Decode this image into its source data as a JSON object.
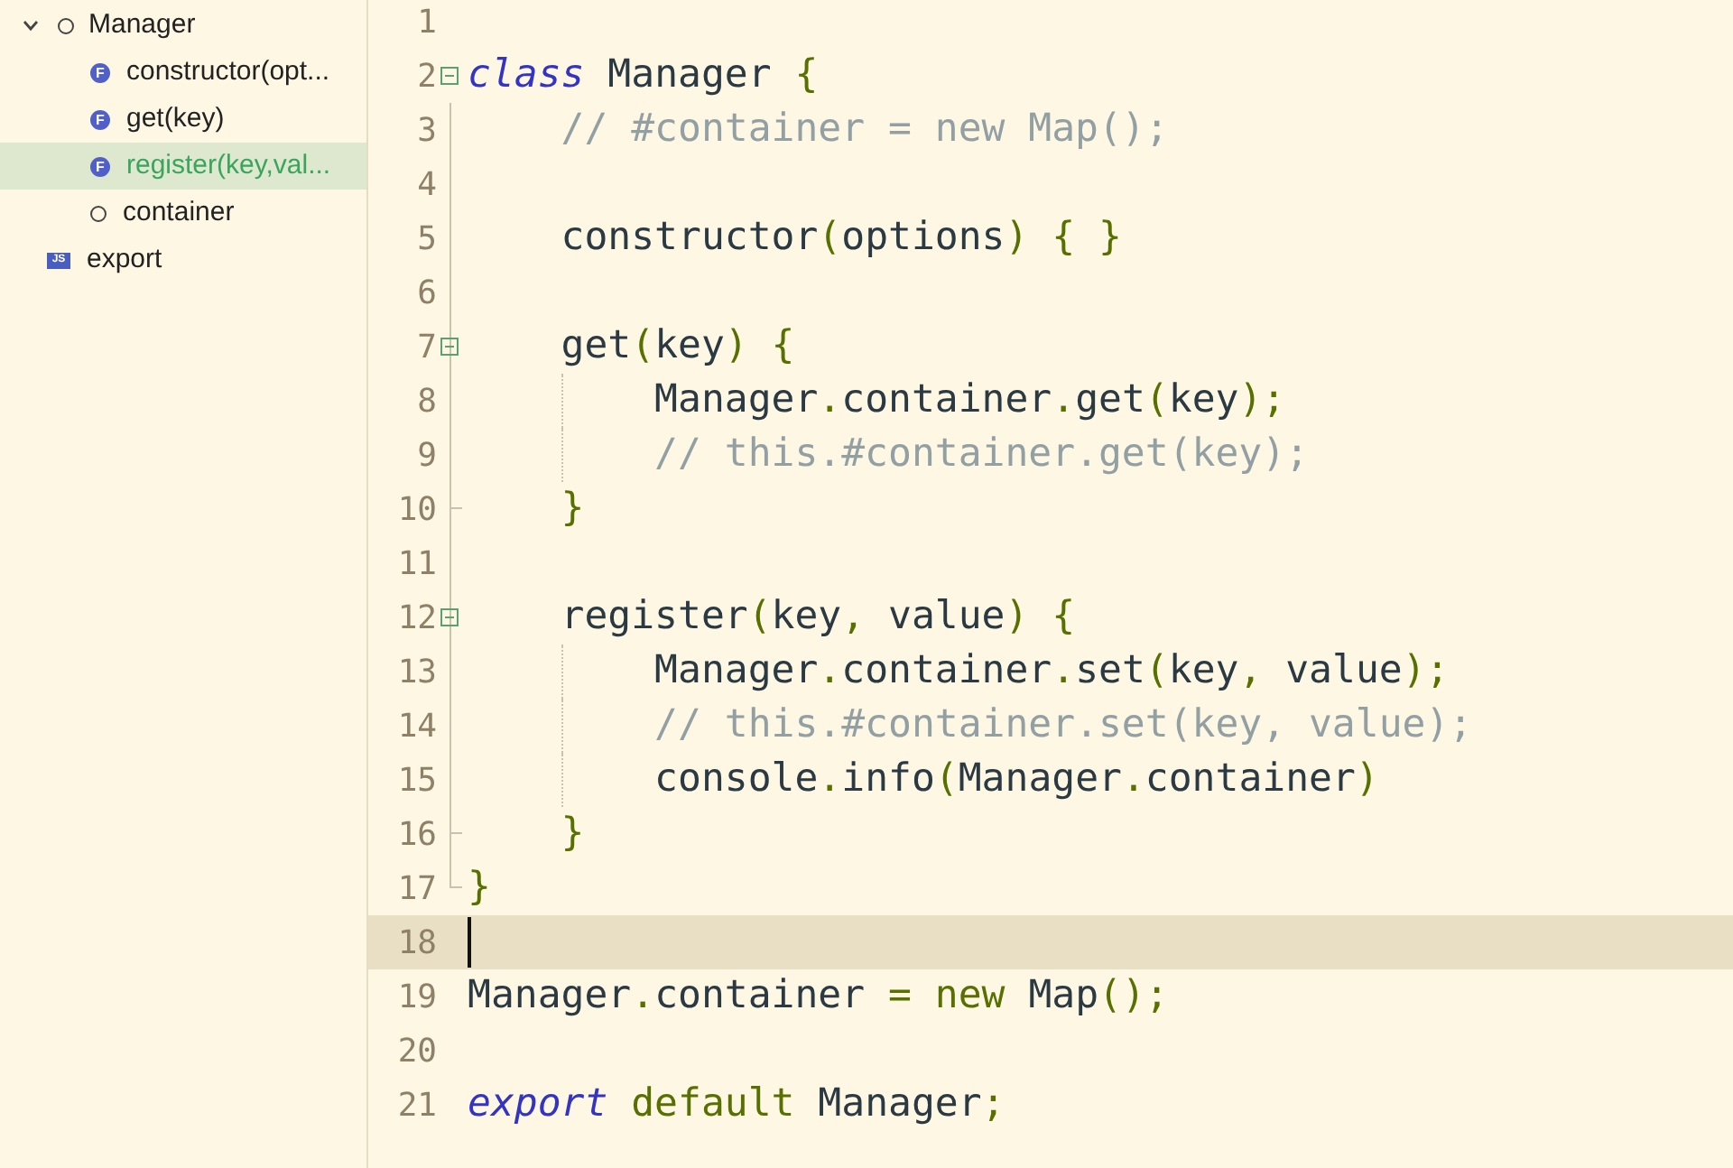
{
  "outline": {
    "items": [
      {
        "label": "Manager",
        "kind": "class",
        "expanded": true,
        "selected": false,
        "children": [
          {
            "label": "constructor(opt...",
            "kind": "method",
            "badge": "F",
            "selected": false
          },
          {
            "label": "get(key)",
            "kind": "method",
            "badge": "F",
            "selected": false
          },
          {
            "label": "register(key,val...",
            "kind": "method",
            "badge": "F",
            "selected": true
          },
          {
            "label": "container",
            "kind": "field",
            "selected": false
          }
        ]
      },
      {
        "label": "export",
        "kind": "module",
        "badge": "JS",
        "expanded": false,
        "selected": false
      }
    ]
  },
  "editor": {
    "lines": [
      {
        "number": "1"
      },
      {
        "number": "2",
        "fold_start": true,
        "tokens": [
          {
            "text": "class",
            "kind": "keyword"
          },
          {
            "text": " Manager ",
            "kind": "plain"
          },
          {
            "text": "{",
            "kind": "punct"
          }
        ]
      },
      {
        "number": "3",
        "tokens": [
          {
            "text": "    // #container = new Map();",
            "kind": "comment"
          }
        ]
      },
      {
        "number": "4"
      },
      {
        "number": "5",
        "tokens": [
          {
            "text": "    constructor",
            "kind": "plain"
          },
          {
            "text": "(",
            "kind": "punct"
          },
          {
            "text": "options",
            "kind": "plain"
          },
          {
            "text": ") { }",
            "kind": "punct"
          }
        ]
      },
      {
        "number": "6"
      },
      {
        "number": "7",
        "fold_start": true,
        "tokens": [
          {
            "text": "    get",
            "kind": "plain"
          },
          {
            "text": "(",
            "kind": "punct"
          },
          {
            "text": "key",
            "kind": "plain"
          },
          {
            "text": ") {",
            "kind": "punct"
          }
        ]
      },
      {
        "number": "8",
        "guide": true,
        "tokens": [
          {
            "text": "        Manager",
            "kind": "plain"
          },
          {
            "text": ".",
            "kind": "punct"
          },
          {
            "text": "container",
            "kind": "plain"
          },
          {
            "text": ".",
            "kind": "punct"
          },
          {
            "text": "get",
            "kind": "plain"
          },
          {
            "text": "(",
            "kind": "punct"
          },
          {
            "text": "key",
            "kind": "plain"
          },
          {
            "text": ");",
            "kind": "punct"
          }
        ]
      },
      {
        "number": "9",
        "guide": true,
        "tokens": [
          {
            "text": "        // this.#container.get(key);",
            "kind": "comment"
          }
        ]
      },
      {
        "number": "10",
        "fold_end": true,
        "tokens": [
          {
            "text": "    }",
            "kind": "punct"
          }
        ]
      },
      {
        "number": "11"
      },
      {
        "number": "12",
        "fold_start": true,
        "tokens": [
          {
            "text": "    register",
            "kind": "plain"
          },
          {
            "text": "(",
            "kind": "punct"
          },
          {
            "text": "key",
            "kind": "plain"
          },
          {
            "text": ", ",
            "kind": "punct"
          },
          {
            "text": "value",
            "kind": "plain"
          },
          {
            "text": ") {",
            "kind": "punct"
          }
        ]
      },
      {
        "number": "13",
        "guide": true,
        "tokens": [
          {
            "text": "        Manager",
            "kind": "plain"
          },
          {
            "text": ".",
            "kind": "punct"
          },
          {
            "text": "container",
            "kind": "plain"
          },
          {
            "text": ".",
            "kind": "punct"
          },
          {
            "text": "set",
            "kind": "plain"
          },
          {
            "text": "(",
            "kind": "punct"
          },
          {
            "text": "key",
            "kind": "plain"
          },
          {
            "text": ", ",
            "kind": "punct"
          },
          {
            "text": "value",
            "kind": "plain"
          },
          {
            "text": ");",
            "kind": "punct"
          }
        ]
      },
      {
        "number": "14",
        "guide": true,
        "tokens": [
          {
            "text": "        // this.#container.set(key, value);",
            "kind": "comment"
          }
        ]
      },
      {
        "number": "15",
        "guide": true,
        "tokens": [
          {
            "text": "        console",
            "kind": "plain"
          },
          {
            "text": ".",
            "kind": "punct"
          },
          {
            "text": "info",
            "kind": "plain"
          },
          {
            "text": "(",
            "kind": "punct"
          },
          {
            "text": "Manager",
            "kind": "plain"
          },
          {
            "text": ".",
            "kind": "punct"
          },
          {
            "text": "container",
            "kind": "plain"
          },
          {
            "text": ")",
            "kind": "punct"
          }
        ]
      },
      {
        "number": "16",
        "fold_end": true,
        "tokens": [
          {
            "text": "    }",
            "kind": "punct"
          }
        ]
      },
      {
        "number": "17",
        "fold_end": true,
        "tokens": [
          {
            "text": "}",
            "kind": "punct"
          }
        ]
      },
      {
        "number": "18",
        "current": true
      },
      {
        "number": "19",
        "tokens": [
          {
            "text": "Manager",
            "kind": "plain"
          },
          {
            "text": ".",
            "kind": "punct"
          },
          {
            "text": "container ",
            "kind": "plain"
          },
          {
            "text": "= new",
            "kind": "punct"
          },
          {
            "text": " Map",
            "kind": "plain"
          },
          {
            "text": "();",
            "kind": "punct"
          }
        ]
      },
      {
        "number": "20"
      },
      {
        "number": "21",
        "tokens": [
          {
            "text": "export",
            "kind": "keyword"
          },
          {
            "text": " default",
            "kind": "punct"
          },
          {
            "text": " Manager",
            "kind": "plain"
          },
          {
            "text": ";",
            "kind": "punct"
          }
        ]
      }
    ]
  }
}
